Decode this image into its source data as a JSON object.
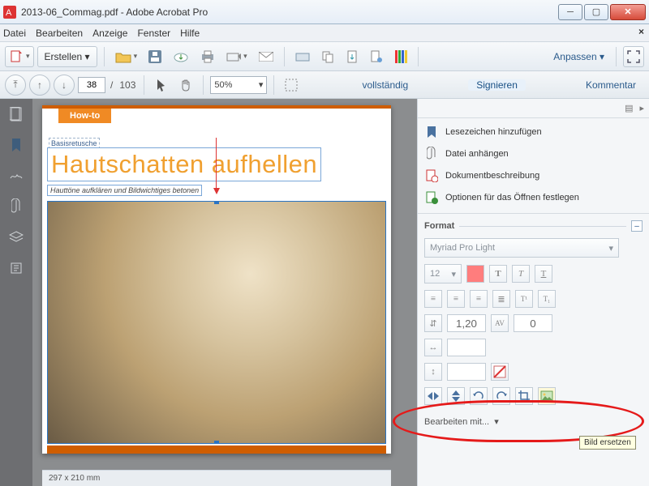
{
  "window": {
    "title": "2013-06_Commag.pdf - Adobe Acrobat Pro"
  },
  "menu": {
    "items": [
      "Datei",
      "Bearbeiten",
      "Anzeige",
      "Fenster",
      "Hilfe"
    ]
  },
  "toolbar1": {
    "erstellen": "Erstellen",
    "anpassen": "Anpassen"
  },
  "toolbar2": {
    "page_current": "38",
    "page_total": "103",
    "zoom": "50%",
    "right_links": [
      "vollständig",
      "Signieren",
      "Kommentar"
    ]
  },
  "document": {
    "howto": "How-to",
    "basis": "Basisretusche",
    "headline": "Hautschatten aufhellen",
    "subline": "Hauttöne aufklären und Bildwichtiges betonen",
    "status": "297 x 210 mm"
  },
  "rpanel": {
    "actions": [
      "Lesezeichen hinzufügen",
      "Datei anhängen",
      "Dokumentbeschreibung",
      "Optionen für das Öffnen festlegen"
    ],
    "format_label": "Format",
    "font": "Myriad Pro Light",
    "font_size": "12",
    "line_height": "1,20",
    "av": "AV",
    "kerning": "0",
    "edit_with": "Bearbeiten mit...",
    "tooltip": "Bild ersetzen"
  }
}
